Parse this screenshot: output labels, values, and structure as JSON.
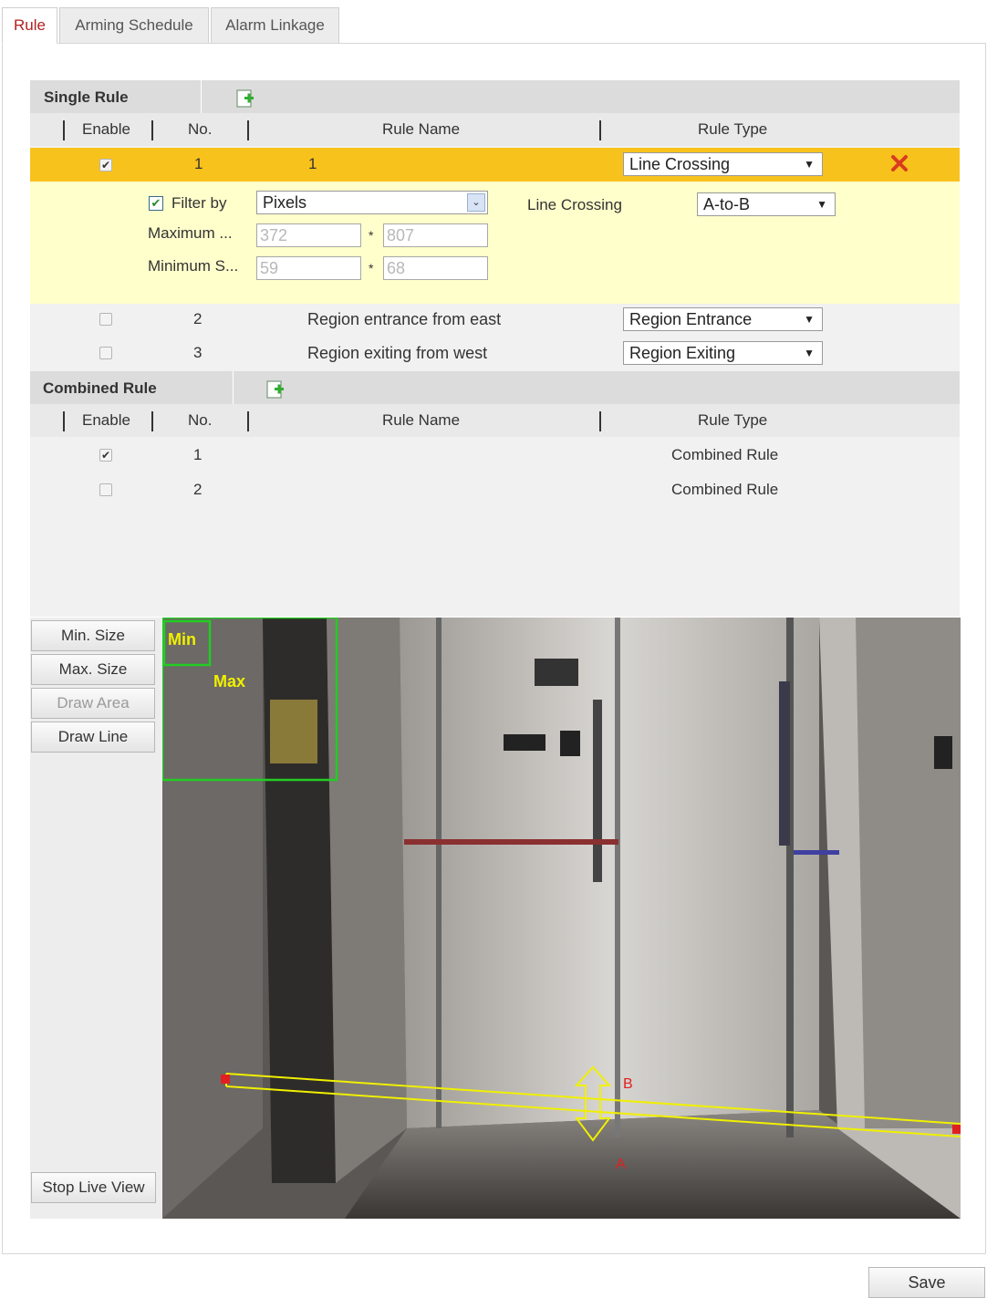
{
  "tabs": [
    {
      "label": "Rule",
      "active": true
    },
    {
      "label": "Arming Schedule",
      "active": false
    },
    {
      "label": "Alarm Linkage",
      "active": false
    }
  ],
  "single_rule": {
    "title": "Single Rule",
    "headers": {
      "enable": "Enable",
      "no": "No.",
      "name": "Rule Name",
      "type": "Rule Type"
    },
    "selected_row": {
      "enabled": true,
      "no": "1",
      "name": "1",
      "type": "Line Crossing",
      "filter": {
        "checkbox_label": "Filter by",
        "checked": true,
        "filter_type": "Pixels",
        "max_label": "Maximum ...",
        "max_w": "372",
        "max_h": "807",
        "min_label": "Minimum S...",
        "min_w": "59",
        "min_h": "68",
        "direction_label": "Line Crossing",
        "direction": "A-to-B",
        "times": "*"
      }
    },
    "rows": [
      {
        "enabled": false,
        "no": "2",
        "name": "Region entrance from east",
        "type": "Region Entrance"
      },
      {
        "enabled": false,
        "no": "3",
        "name": "Region exiting from west",
        "type": "Region Exiting"
      }
    ]
  },
  "combined_rule": {
    "title": "Combined Rule",
    "headers": {
      "enable": "Enable",
      "no": "No.",
      "name": "Rule Name",
      "type": "Rule Type"
    },
    "rows": [
      {
        "enabled": true,
        "no": "1",
        "type": "Combined Rule"
      },
      {
        "enabled": false,
        "no": "2",
        "type": "Combined Rule"
      }
    ]
  },
  "tools": {
    "min_size": "Min. Size",
    "max_size": "Max. Size",
    "draw_area": "Draw Area",
    "draw_line": "Draw Line",
    "stop_live_view": "Stop Live View"
  },
  "video_overlay": {
    "min_label": "Min",
    "max_label": "Max",
    "point_b": "B",
    "point_a": "A"
  },
  "save_label": "Save",
  "colors": {
    "selected_row": "#f8c21c",
    "filter_panel": "#ffffcc",
    "active_tab": "#b22222",
    "overlay_line": "#f0f000",
    "size_box": "#22cc22"
  },
  "icons": [
    "add-rule-icon",
    "delete-rule-icon",
    "dropdown-arrow-icon",
    "checkbox-icon"
  ]
}
